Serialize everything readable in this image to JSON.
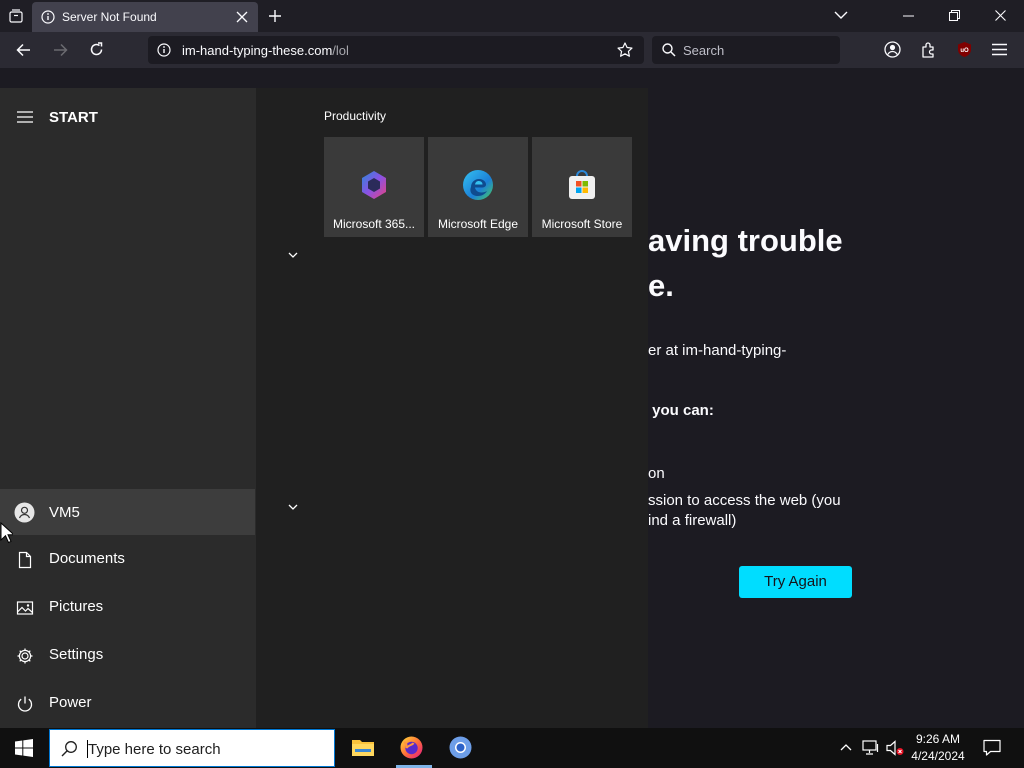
{
  "browser": {
    "tab_title": "Server Not Found",
    "url_host": "im-hand-typing-these.com",
    "url_path": "/lol",
    "search_placeholder": "Search"
  },
  "error_page": {
    "title_line1": "aving trouble",
    "title_line2": "e.",
    "line_server": "er at im-hand-typing-",
    "line_you_can": " you can:",
    "line_on": "on",
    "line_permission1": "ssion to access the web (you",
    "line_permission2": "ind a firewall)",
    "try_again_label": "Try Again",
    "accent_color": "#00ddff"
  },
  "start_menu": {
    "title": "START",
    "group_label": "Productivity",
    "tiles": [
      {
        "label": "Microsoft 365...",
        "icon": "microsoft-365-icon"
      },
      {
        "label": "Microsoft Edge",
        "icon": "edge-icon"
      },
      {
        "label": "Microsoft Store",
        "icon": "store-icon"
      }
    ],
    "user_name": "VM5",
    "side_items": [
      {
        "label": "Documents",
        "icon": "document-icon"
      },
      {
        "label": "Pictures",
        "icon": "pictures-icon"
      },
      {
        "label": "Settings",
        "icon": "gear-icon"
      },
      {
        "label": "Power",
        "icon": "power-icon"
      }
    ]
  },
  "taskbar": {
    "search_placeholder": "Type here to search",
    "time": "9:26 AM",
    "date": "4/24/2024"
  }
}
